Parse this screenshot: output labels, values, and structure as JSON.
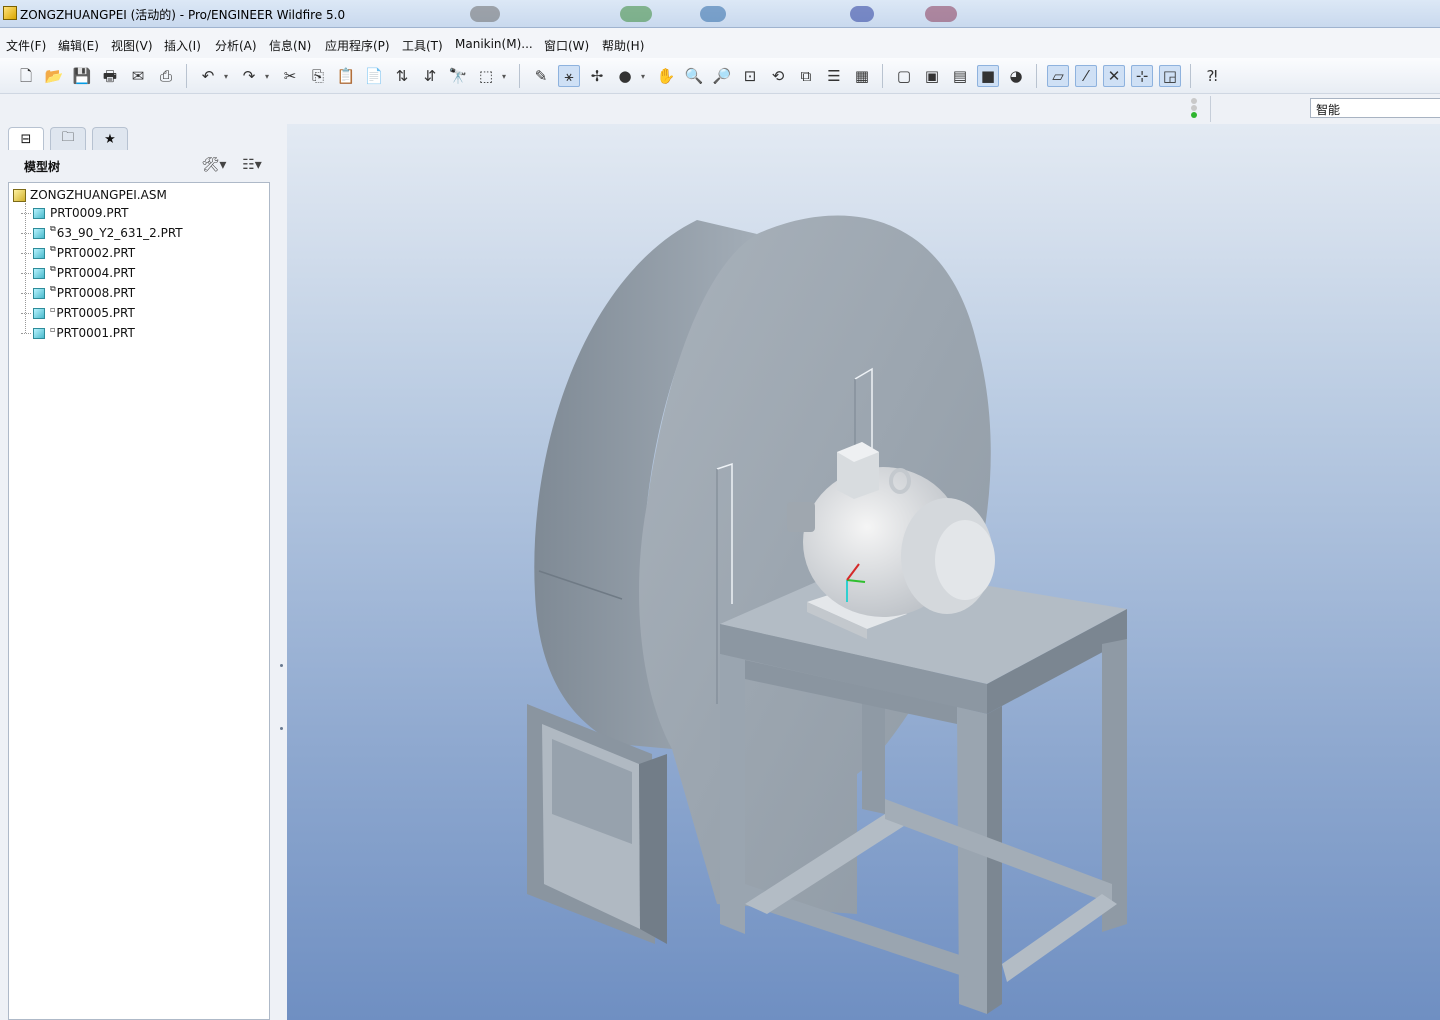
{
  "window": {
    "title": "ZONGZHUANGPEI (活动的) - Pro/ENGINEER Wildfire 5.0"
  },
  "menu": [
    {
      "label": "文件(F)"
    },
    {
      "label": "编辑(E)"
    },
    {
      "label": "视图(V)"
    },
    {
      "label": "插入(I)"
    },
    {
      "label": "分析(A)"
    },
    {
      "label": "信息(N)"
    },
    {
      "label": "应用程序(P)"
    },
    {
      "label": "工具(T)"
    },
    {
      "label": "Manikin(M)..."
    },
    {
      "label": "窗口(W)"
    },
    {
      "label": "帮助(H)"
    }
  ],
  "toolbar": {
    "icons": [
      "new-icon",
      "open-icon",
      "save-icon",
      "print-icon",
      "email-icon",
      "mail-icon",
      "undo-icon",
      "redo-icon",
      "cut-icon",
      "copy-icon",
      "paste-icon",
      "paste-special-icon",
      "regenerate-icon",
      "regen-manager-icon",
      "find-icon",
      "select-box-icon",
      "sketch-icon",
      "datum-display-icon",
      "spin-center-icon",
      "shading-icon",
      "pan-icon",
      "zoom-in-icon",
      "zoom-out-icon",
      "refit-icon",
      "reorient-icon",
      "saved-views-icon",
      "layers-icon",
      "view-manager-icon",
      "wireframe-icon",
      "hidden-line-icon",
      "no-hidden-icon",
      "shaded-icon",
      "enhanced-realism-icon",
      "datum-plane-icon",
      "datum-axis-icon",
      "datum-point-icon",
      "coord-sys-icon",
      "annotation-icon",
      "whats-this-icon"
    ]
  },
  "filter": {
    "value": "智能"
  },
  "panel": {
    "tree_title": "模型树",
    "root": {
      "label": "ZONGZHUANGPEI.ASM"
    },
    "items": [
      {
        "label": "PRT0009.PRT",
        "mark": ""
      },
      {
        "label": "63_90_Y2_631_2.PRT",
        "mark": "⧉"
      },
      {
        "label": "PRT0002.PRT",
        "mark": "⧉"
      },
      {
        "label": "PRT0004.PRT",
        "mark": "⧉"
      },
      {
        "label": "PRT0008.PRT",
        "mark": "⧉"
      },
      {
        "label": "PRT0005.PRT",
        "mark": "▫"
      },
      {
        "label": "PRT0001.PRT",
        "mark": "▫"
      }
    ]
  },
  "colors": {
    "viewport_top": "#e3eaf3",
    "viewport_bottom": "#6f8fc2",
    "model_gray": "#a9b3bd"
  }
}
